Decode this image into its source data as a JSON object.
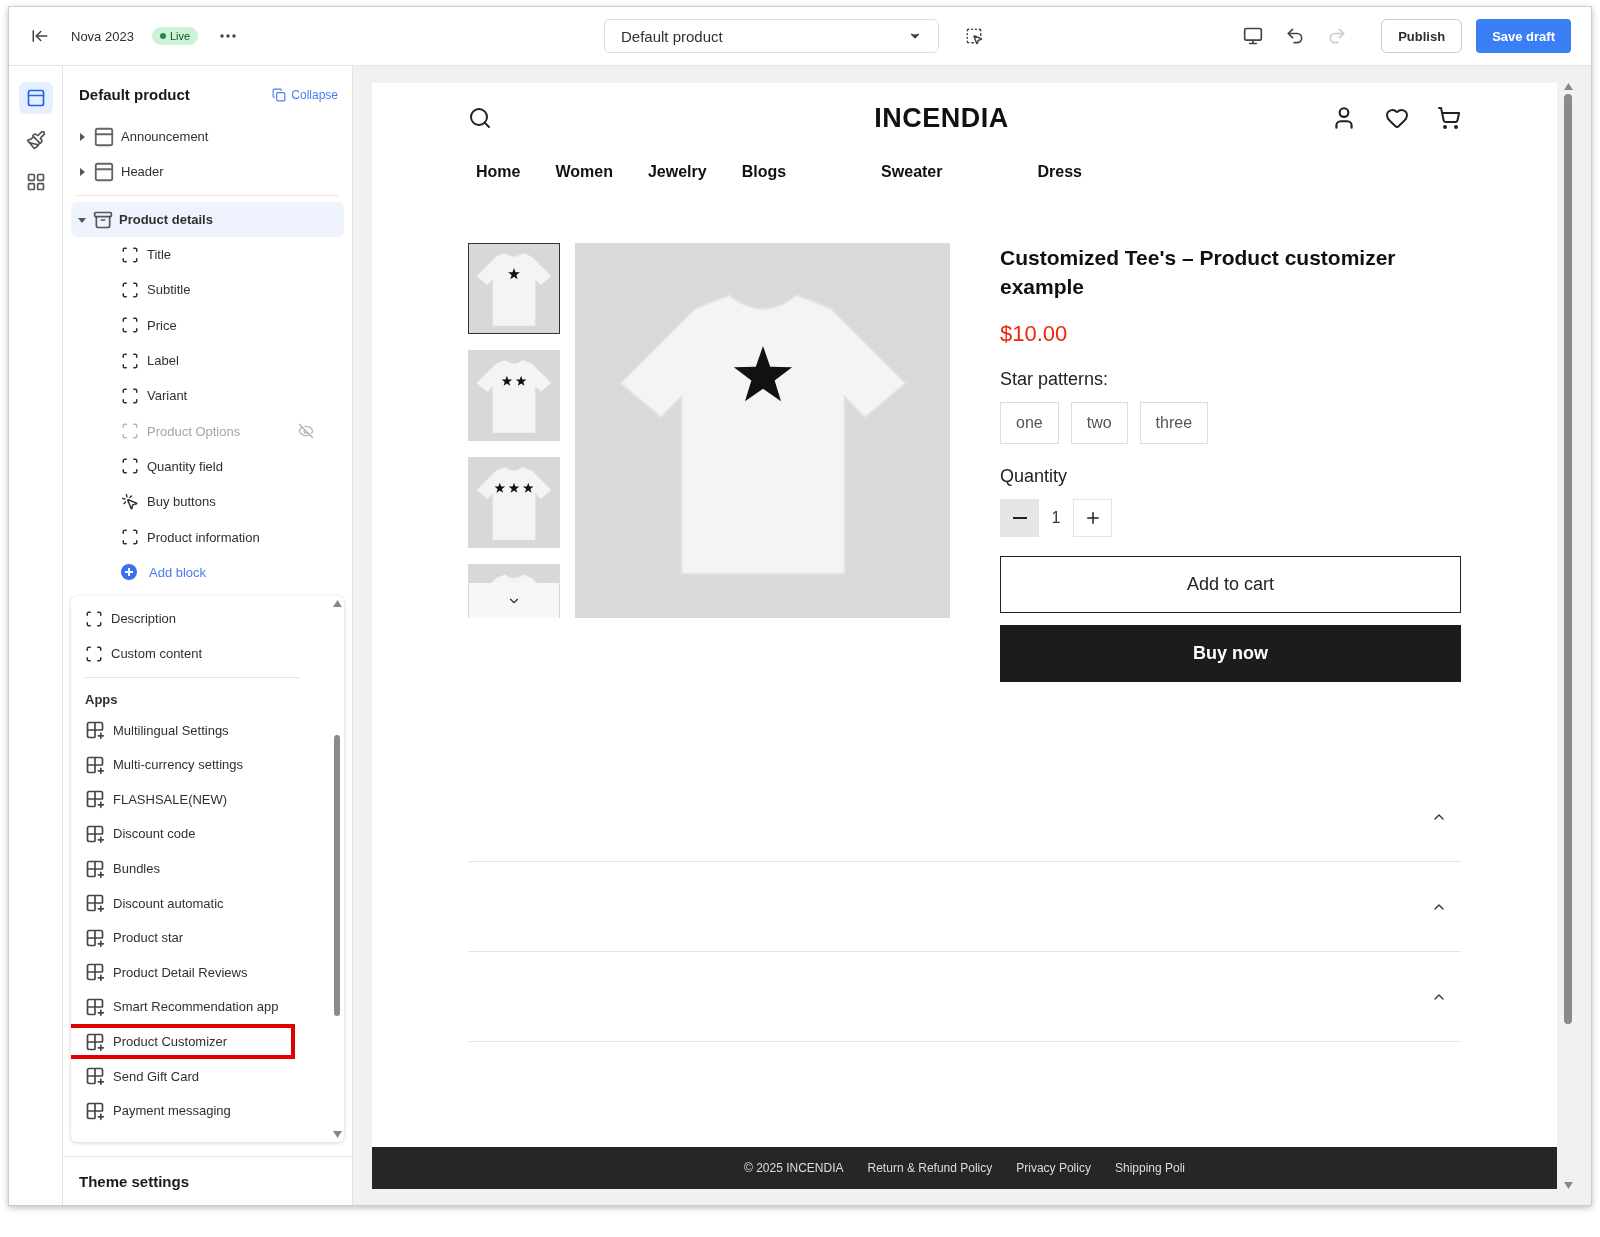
{
  "topbar": {
    "theme_name": "Nova 2023",
    "status": "Live",
    "template": "Default product",
    "publish": "Publish",
    "save": "Save draft"
  },
  "rail": [
    {
      "kind": "sections",
      "selected": true
    },
    {
      "kind": "theme",
      "selected": false
    },
    {
      "kind": "apps",
      "selected": false
    }
  ],
  "sidebar": {
    "title": "Default product",
    "collapse": "Collapse",
    "sections": [
      {
        "label": "Announcement",
        "kind": "bar",
        "expanded": false,
        "selected": false
      },
      {
        "label": "Header",
        "kind": "bar",
        "expanded": false,
        "selected": false
      },
      {
        "label": "Product details",
        "kind": "product",
        "expanded": true,
        "selected": true,
        "children": [
          {
            "label": "Title",
            "kind": "block",
            "hidden": false
          },
          {
            "label": "Subtitle",
            "kind": "block",
            "hidden": false
          },
          {
            "label": "Price",
            "kind": "block",
            "hidden": false
          },
          {
            "label": "Label",
            "kind": "block",
            "hidden": false
          },
          {
            "label": "Variant",
            "kind": "block",
            "hidden": false
          },
          {
            "label": "Product Options",
            "kind": "block",
            "hidden": true
          },
          {
            "label": "Quantity field",
            "kind": "block",
            "hidden": false
          },
          {
            "label": "Buy buttons",
            "kind": "buy",
            "hidden": false
          },
          {
            "label": "Product information",
            "kind": "block",
            "hidden": false
          }
        ]
      }
    ],
    "add_block": "Add block",
    "blocks": [
      "Description",
      "Custom content"
    ],
    "apps_heading": "Apps",
    "apps": [
      {
        "label": "Multilingual Settings",
        "highlighted": false
      },
      {
        "label": "Multi-currency settings",
        "highlighted": false
      },
      {
        "label": "FLASHSALE(NEW)",
        "highlighted": false
      },
      {
        "label": "Discount code",
        "highlighted": false
      },
      {
        "label": "Bundles",
        "highlighted": false
      },
      {
        "label": "Discount automatic",
        "highlighted": false
      },
      {
        "label": "Product star",
        "highlighted": false
      },
      {
        "label": "Product Detail Reviews",
        "highlighted": false
      },
      {
        "label": "Smart Recommendation app",
        "highlighted": false
      },
      {
        "label": "Product Customizer",
        "highlighted": true
      },
      {
        "label": "Send Gift Card",
        "highlighted": false
      },
      {
        "label": "Payment messaging",
        "highlighted": false
      }
    ],
    "theme_settings": "Theme settings"
  },
  "preview": {
    "logo": "INCENDIA",
    "nav": [
      "Home",
      "Women",
      "Jewelry",
      "Blogs",
      "Sweater",
      "Dress"
    ],
    "thumbnails": [
      {
        "kind": "single",
        "selected": true
      },
      {
        "kind": "double",
        "selected": false
      },
      {
        "kind": "triple",
        "selected": false
      },
      {
        "kind": "partial",
        "selected": false
      }
    ],
    "product": {
      "title": "Customized Tee's – Product customizer example",
      "price": "$10.00",
      "option_label": "Star patterns:",
      "options": [
        "one",
        "two",
        "three"
      ],
      "quantity_label": "Quantity",
      "quantity": "1",
      "add_to_cart": "Add to cart",
      "buy_now": "Buy now"
    },
    "footer": [
      "© 2025 INCENDIA",
      "Return & Refund Policy",
      "Privacy Policy",
      "Shipping Poli"
    ]
  }
}
